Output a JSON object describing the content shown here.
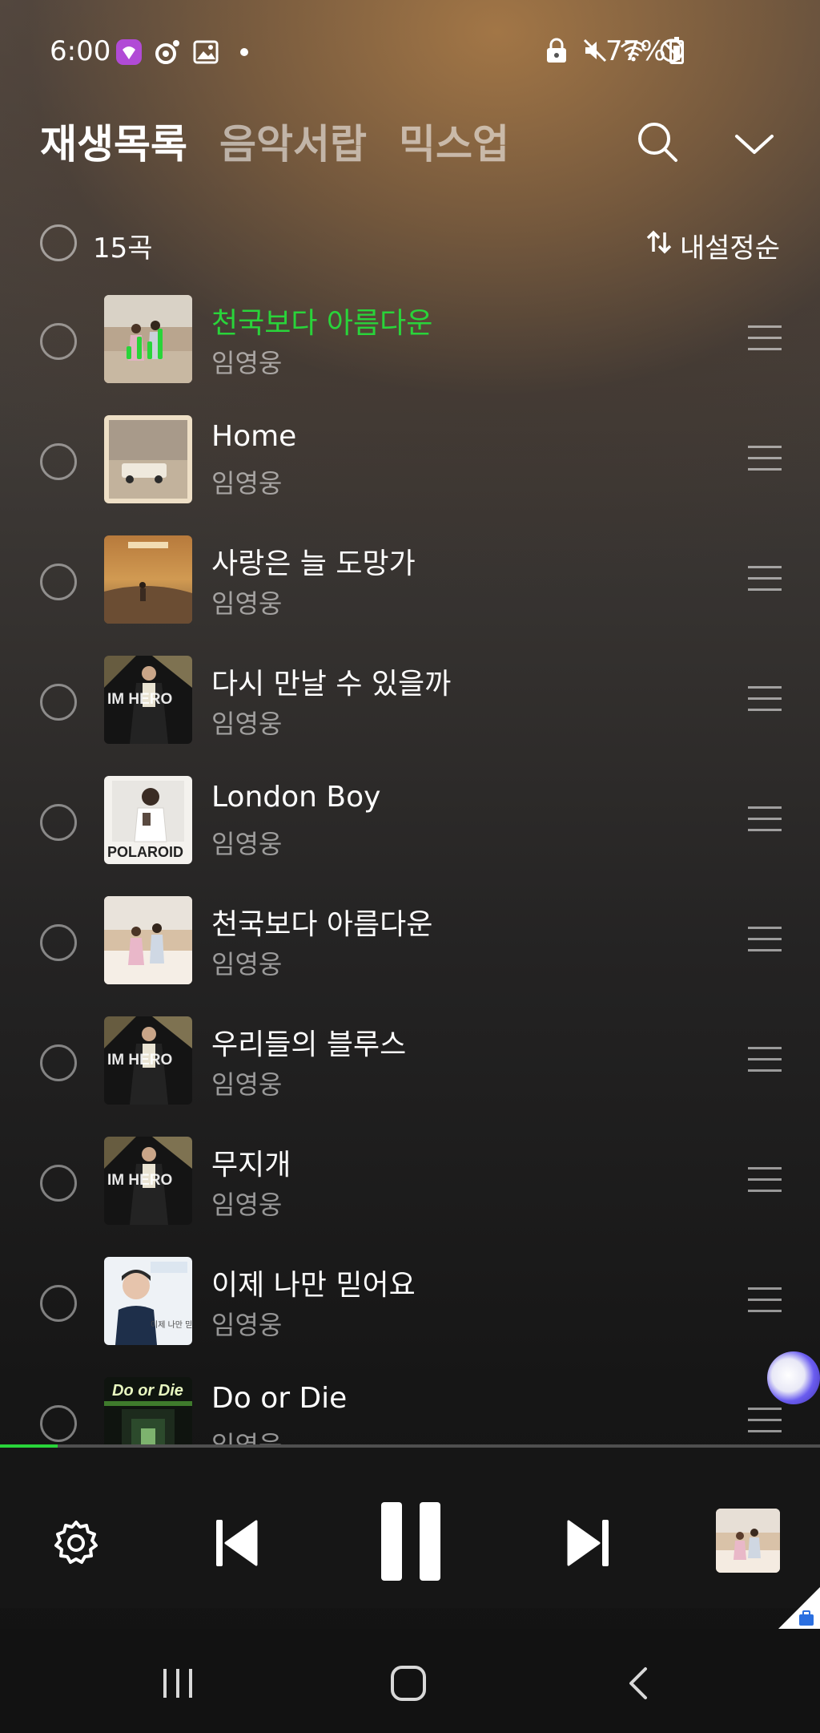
{
  "status_bar": {
    "time": "6:00",
    "battery_percent": "77%",
    "icons_left": [
      "app-badge-icon",
      "record-icon",
      "gallery-icon",
      "dot-icon"
    ],
    "icons_right": [
      "lock-icon",
      "mute-icon",
      "wifi-icon",
      "block-icon",
      "battery-icon"
    ]
  },
  "tabs": [
    {
      "label": "재생목록",
      "active": true
    },
    {
      "label": "음악서랍",
      "active": false
    },
    {
      "label": "믹스업",
      "active": false
    }
  ],
  "list_header": {
    "count_label": "15곡",
    "sort_label": "내설정순"
  },
  "songs": [
    {
      "title": "천국보다 아름다운",
      "artist": "임영웅",
      "playing": true,
      "art": "beach"
    },
    {
      "title": "Home",
      "artist": "임영웅",
      "playing": false,
      "art": "home"
    },
    {
      "title": "사랑은 늘 도망가",
      "artist": "임영웅",
      "playing": false,
      "art": "sunset"
    },
    {
      "title": "다시 만날 수 있을까",
      "artist": "임영웅",
      "playing": false,
      "art": "imhero",
      "art_text": "IM HERO"
    },
    {
      "title": "London Boy",
      "artist": "임영웅",
      "playing": false,
      "art": "polaroid",
      "art_text": "POLAROID"
    },
    {
      "title": "천국보다 아름다운",
      "artist": "임영웅",
      "playing": false,
      "art": "beach2"
    },
    {
      "title": "우리들의 블루스",
      "artist": "임영웅",
      "playing": false,
      "art": "imhero",
      "art_text": "IM HERO"
    },
    {
      "title": "무지개",
      "artist": "임영웅",
      "playing": false,
      "art": "imhero",
      "art_text": "IM HERO"
    },
    {
      "title": "이제 나만 믿어요",
      "artist": "임영웅",
      "playing": false,
      "art": "portrait"
    },
    {
      "title": "Do or Die",
      "artist": "임영웅",
      "playing": false,
      "art": "doordie",
      "art_text": "Do or Die"
    }
  ],
  "progress": 0.07,
  "player": {
    "controls": [
      "settings-icon",
      "previous-icon",
      "pause-icon",
      "next-icon"
    ]
  },
  "colors": {
    "accent": "#29d43a",
    "background_top": "#a67846",
    "background_bottom": "#121212"
  }
}
